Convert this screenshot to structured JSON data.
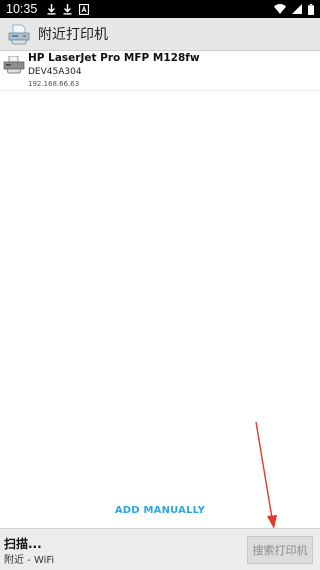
{
  "status_bar": {
    "time": "10:35",
    "left_icons": [
      "download-icon",
      "download-icon",
      "a-badge-icon"
    ],
    "right_icons": [
      "wifi-icon",
      "signal-icon",
      "battery-icon"
    ]
  },
  "header": {
    "title": "附近打印机",
    "icon": "printer-icon",
    "background": "#e7e7e7"
  },
  "printers": [
    {
      "name": "HP LaserJet Pro MFP M128fw",
      "model": "DEV45A304",
      "ip": "192.168.66.63",
      "icon": "printer-icon"
    }
  ],
  "actions": {
    "add_manually": "ADD MANUALLY",
    "accent": "#2ea7e0"
  },
  "bottom_bar": {
    "status_title": "扫描...",
    "status_sub": "附近 - WiFi",
    "search_button": "搜索打印机"
  },
  "annotation": {
    "arrow_color": "#e23c2c"
  }
}
